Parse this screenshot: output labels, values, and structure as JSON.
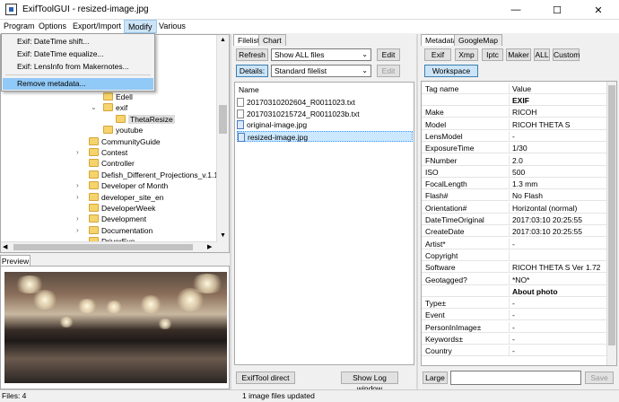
{
  "window": {
    "title": "ExifToolGUI - resized-image.jpg",
    "minimize": "—",
    "maximize": "☐",
    "close": "✕"
  },
  "menu": {
    "items": [
      "Program",
      "Options",
      "Export/Import",
      "Modify",
      "Various"
    ],
    "active": "Modify"
  },
  "modify_menu": {
    "items": [
      "Exif: DateTime shift...",
      "Exif: DateTime equalize...",
      "Exif: LensInfo from Makernotes...",
      "Remove metadata..."
    ],
    "highlighted": "Remove metadata..."
  },
  "folder_tree": {
    "items": [
      {
        "label": "Edell",
        "indent": 1
      },
      {
        "label": "exif",
        "indent": 1,
        "expanded": true
      },
      {
        "label": "ThetaResize",
        "indent": 2,
        "selected": true
      },
      {
        "label": "youtube",
        "indent": 1
      },
      {
        "label": "CommunityGuide",
        "indent": 0
      },
      {
        "label": "Contest",
        "indent": 0,
        "expandable": true
      },
      {
        "label": "Controller",
        "indent": 0
      },
      {
        "label": "Defish_Different_Projections_v.1.1",
        "indent": 0
      },
      {
        "label": "Developer of Month",
        "indent": 0,
        "expandable": true
      },
      {
        "label": "developer_site_en",
        "indent": 0,
        "expandable": true
      },
      {
        "label": "DeveloperWeek",
        "indent": 0
      },
      {
        "label": "Development",
        "indent": 0,
        "expandable": true
      },
      {
        "label": "Documentation",
        "indent": 0,
        "expandable": true
      },
      {
        "label": "DriverEye",
        "indent": 0
      }
    ]
  },
  "preview": {
    "tab_label": "Preview"
  },
  "filelist_panel": {
    "tabs": [
      "Filelist",
      "Chart"
    ],
    "refresh_label": "Refresh",
    "filter_value": "Show ALL files",
    "edit_label": "Edit",
    "details_label": "Details:",
    "view_value": "Standard filelist",
    "edit2_label": "Edit",
    "column_header": "Name",
    "files": [
      {
        "name": "20170310202604_R0011023.txt",
        "type": "txt"
      },
      {
        "name": "20170310215724_R0011023b.txt",
        "type": "txt"
      },
      {
        "name": "original-image.jpg",
        "type": "img"
      },
      {
        "name": "resized-image.jpg",
        "type": "img",
        "selected": true
      }
    ],
    "exiftool_direct_label": "ExifTool direct",
    "show_log_label": "Show Log window"
  },
  "metadata_panel": {
    "tabs": [
      "Metadata",
      "GoogleMap"
    ],
    "filter_buttons": [
      "Exif",
      "Xmp",
      "Iptc",
      "Maker",
      "ALL",
      "Custom"
    ],
    "workspace_label": "Workspace",
    "col_tag": "Tag name",
    "col_value": "Value",
    "rows": [
      {
        "tag": "",
        "value": "EXIF",
        "bold": true
      },
      {
        "tag": "Make",
        "value": "RICOH"
      },
      {
        "tag": "Model",
        "value": "RICOH THETA S"
      },
      {
        "tag": "LensModel",
        "value": "-"
      },
      {
        "tag": "ExposureTime",
        "value": "1/30"
      },
      {
        "tag": "FNumber",
        "value": "2.0"
      },
      {
        "tag": "ISO",
        "value": "500"
      },
      {
        "tag": "FocalLength",
        "value": "1.3 mm"
      },
      {
        "tag": "Flash#",
        "value": "No Flash"
      },
      {
        "tag": "Orientation#",
        "value": "Horizontal (normal)"
      },
      {
        "tag": "DateTimeOriginal",
        "value": "2017:03:10 20:25:55"
      },
      {
        "tag": "CreateDate",
        "value": "2017:03:10 20:25:55"
      },
      {
        "tag": "Artist*",
        "value": "-"
      },
      {
        "tag": "Copyright",
        "value": ""
      },
      {
        "tag": "Software",
        "value": "RICOH THETA S Ver 1.72"
      },
      {
        "tag": "Geotagged?",
        "value": "*NO*"
      },
      {
        "tag": "",
        "value": "About photo",
        "bold": true
      },
      {
        "tag": "Type±",
        "value": "-"
      },
      {
        "tag": "Event",
        "value": "-"
      },
      {
        "tag": "PersonInImage±",
        "value": "-"
      },
      {
        "tag": "Keywords±",
        "value": "-"
      },
      {
        "tag": "Country",
        "value": "-"
      }
    ],
    "large_label": "Large",
    "save_label": "Save"
  },
  "status": {
    "files": "Files: 4",
    "message": "1 image files updated"
  }
}
